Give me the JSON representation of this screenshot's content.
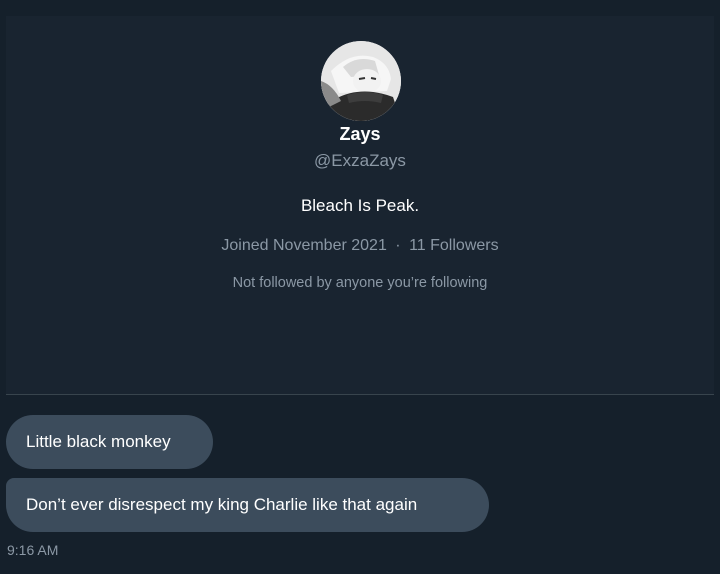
{
  "profile": {
    "name": "Zays",
    "handle": "@ExzaZays",
    "bio": "Bleach Is Peak.",
    "joined": "Joined November 2021",
    "separator": "·",
    "followers": "11 Followers",
    "followed_by": "Not followed by anyone you’re following"
  },
  "messages": [
    {
      "text": "Little black monkey"
    },
    {
      "text": "Don’t ever disrespect my king Charlie like that again"
    }
  ],
  "timestamp": "9:16 AM",
  "colors": {
    "background": "#15202b",
    "card": "#192430",
    "bubble": "#3c4c5c",
    "muted_text": "#8b98a5",
    "text": "#ffffff"
  }
}
